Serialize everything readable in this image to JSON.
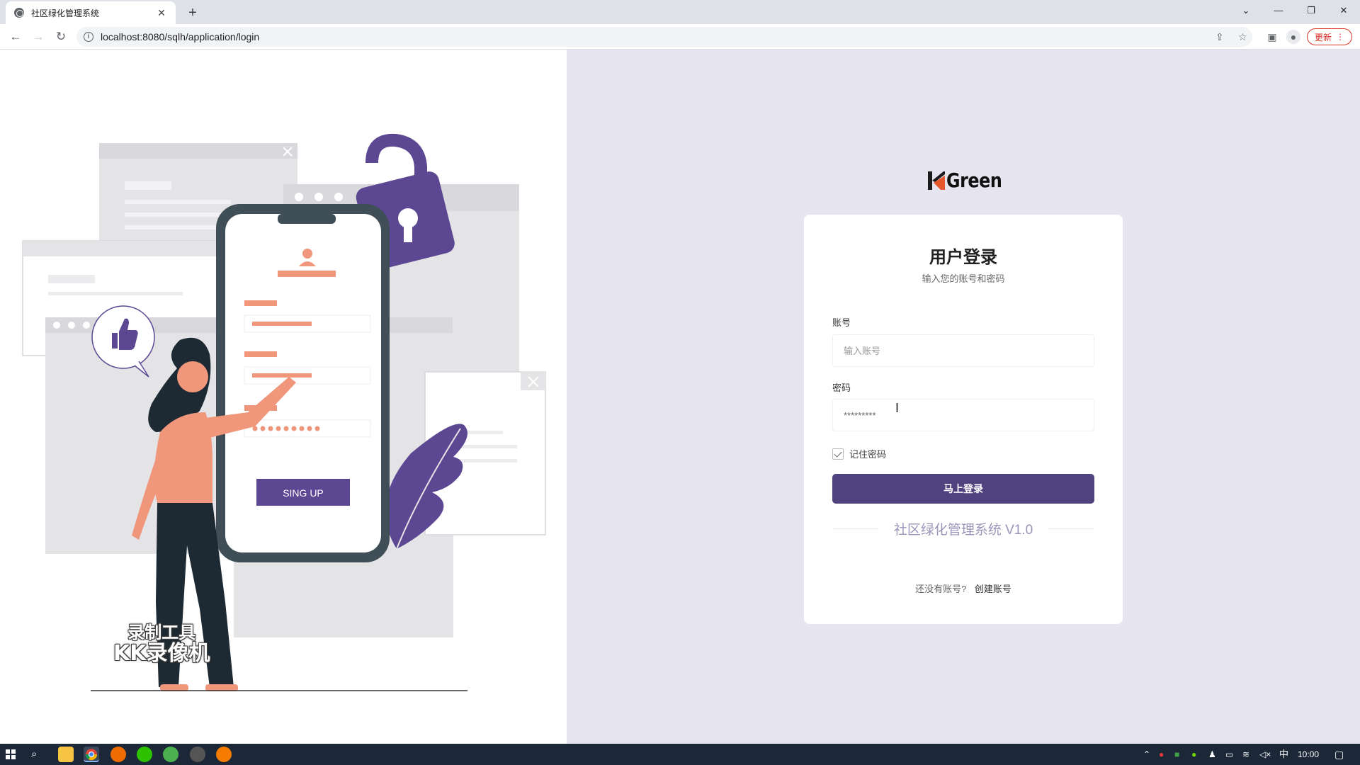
{
  "browser": {
    "tab_title": "社区绿化管理系统",
    "new_tab": "+",
    "url": "localhost:8080/sqlh/application/login",
    "update_label": "更新"
  },
  "brand": {
    "logo_text": "Green",
    "accent_color": "#50427e",
    "logo_colors": [
      "#e5582b",
      "#1c1c1c"
    ]
  },
  "illustration": {
    "button_label": "SING UP",
    "watermark_line1": "录制工具",
    "watermark_line2": "KK录像机"
  },
  "login": {
    "title": "用户登录",
    "subtitle": "输入您的账号和密码",
    "account_label": "账号",
    "account_placeholder": "输入账号",
    "password_label": "密码",
    "password_value": "*********",
    "remember_label": "记住密码",
    "submit_label": "马上登录",
    "system_name": "社区绿化管理系统 V1.0",
    "no_account_text": "还没有账号?",
    "create_account_link": "创建账号"
  },
  "taskbar": {
    "ime": "中",
    "time": "10:00"
  }
}
